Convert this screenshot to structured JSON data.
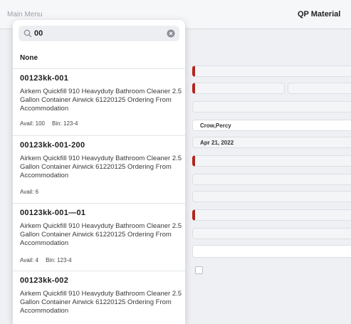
{
  "header": {
    "menu_label": "Main Menu",
    "title": "QP Material"
  },
  "search": {
    "query": "00"
  },
  "dropdown": {
    "none_label": "None",
    "items": [
      {
        "code": "00123kk-001",
        "description": "Airkem Quickfill 910 Heavyduty Bathroom Cleaner 2.5 Gallon Container Airwick 61220125 Ordering From Accommodation",
        "avail": "Avail: 100",
        "bin": "Bin: 123-4"
      },
      {
        "code": "00123kk-001-200",
        "description": "Airkem Quickfill 910 Heavyduty Bathroom Cleaner 2.5 Gallon Container Airwick 61220125 Ordering From Accommodation",
        "avail": "Avail: 6",
        "bin": ""
      },
      {
        "code": "00123kk-001—01",
        "description": "Airkem Quickfill 910 Heavyduty Bathroom Cleaner 2.5 Gallon Container Airwick 61220125 Ordering From Accommodation",
        "avail": "Avail: 4",
        "bin": "Bin: 123-4"
      },
      {
        "code": "00123kk-002",
        "description": "Airkem Quickfill 910 Heavyduty Bathroom Cleaner 2.5 Gallon Container Airwick 61220125 Ordering From Accommodation",
        "avail": "",
        "bin": ""
      }
    ]
  },
  "form": {
    "requested_by": "Crow,Percy",
    "date": "Apr 21, 2022"
  },
  "colors": {
    "required": "#b3261e",
    "background": "#eef0f3"
  }
}
